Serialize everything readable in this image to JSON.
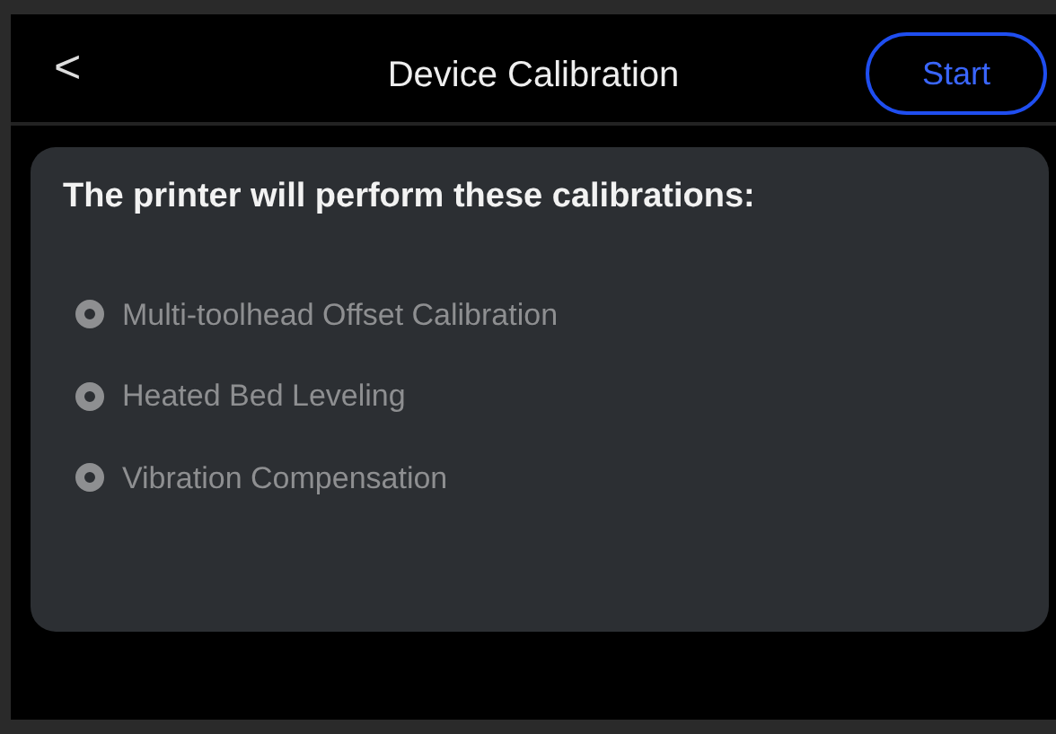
{
  "header": {
    "back": "<",
    "title": "Device Calibration",
    "action": "Start"
  },
  "card": {
    "heading": "The printer will perform these calibrations:",
    "items": [
      {
        "label": "Multi-toolhead Offset Calibration",
        "checked": true,
        "disabled": true
      },
      {
        "label": "Heated Bed Leveling",
        "checked": true,
        "disabled": true
      },
      {
        "label": "Vibration Compensation",
        "checked": true,
        "disabled": true
      }
    ]
  }
}
